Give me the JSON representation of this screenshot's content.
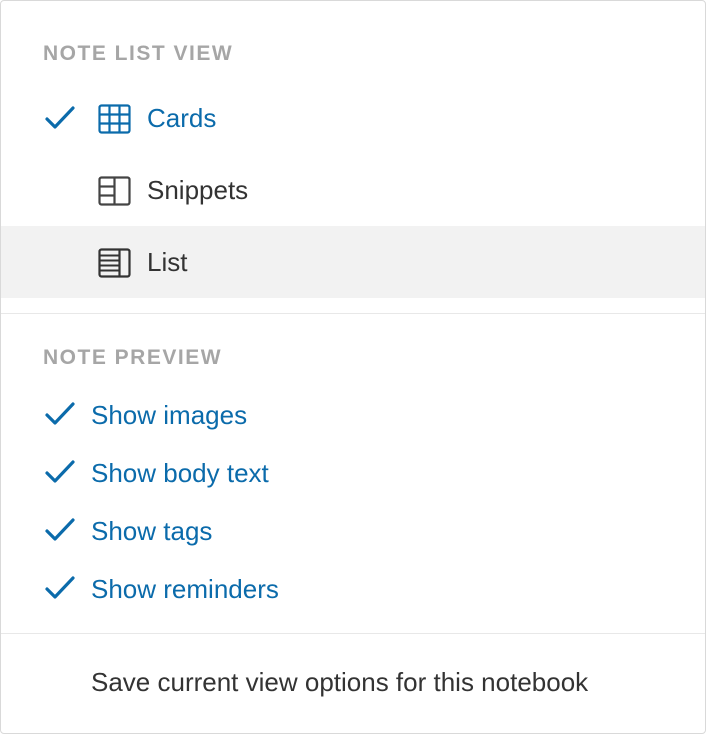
{
  "note_list_view": {
    "heading": "NOTE LIST VIEW",
    "items": [
      {
        "label": "Cards",
        "icon": "cards-icon",
        "selected": true
      },
      {
        "label": "Snippets",
        "icon": "snippets-icon",
        "selected": false
      },
      {
        "label": "List",
        "icon": "list-icon",
        "selected": false,
        "hovered": true
      }
    ]
  },
  "note_preview": {
    "heading": "NOTE PREVIEW",
    "options": [
      {
        "label": "Show images",
        "checked": true
      },
      {
        "label": "Show body text",
        "checked": true
      },
      {
        "label": "Show tags",
        "checked": true
      },
      {
        "label": "Show reminders",
        "checked": true
      }
    ]
  },
  "footer": {
    "save_label": "Save current view options for this notebook"
  },
  "colors": {
    "accent": "#0b6bab",
    "text": "#333333",
    "heading": "#a6a6a6",
    "hover_bg": "#f2f2f2",
    "divider": "#e8e8e8"
  }
}
